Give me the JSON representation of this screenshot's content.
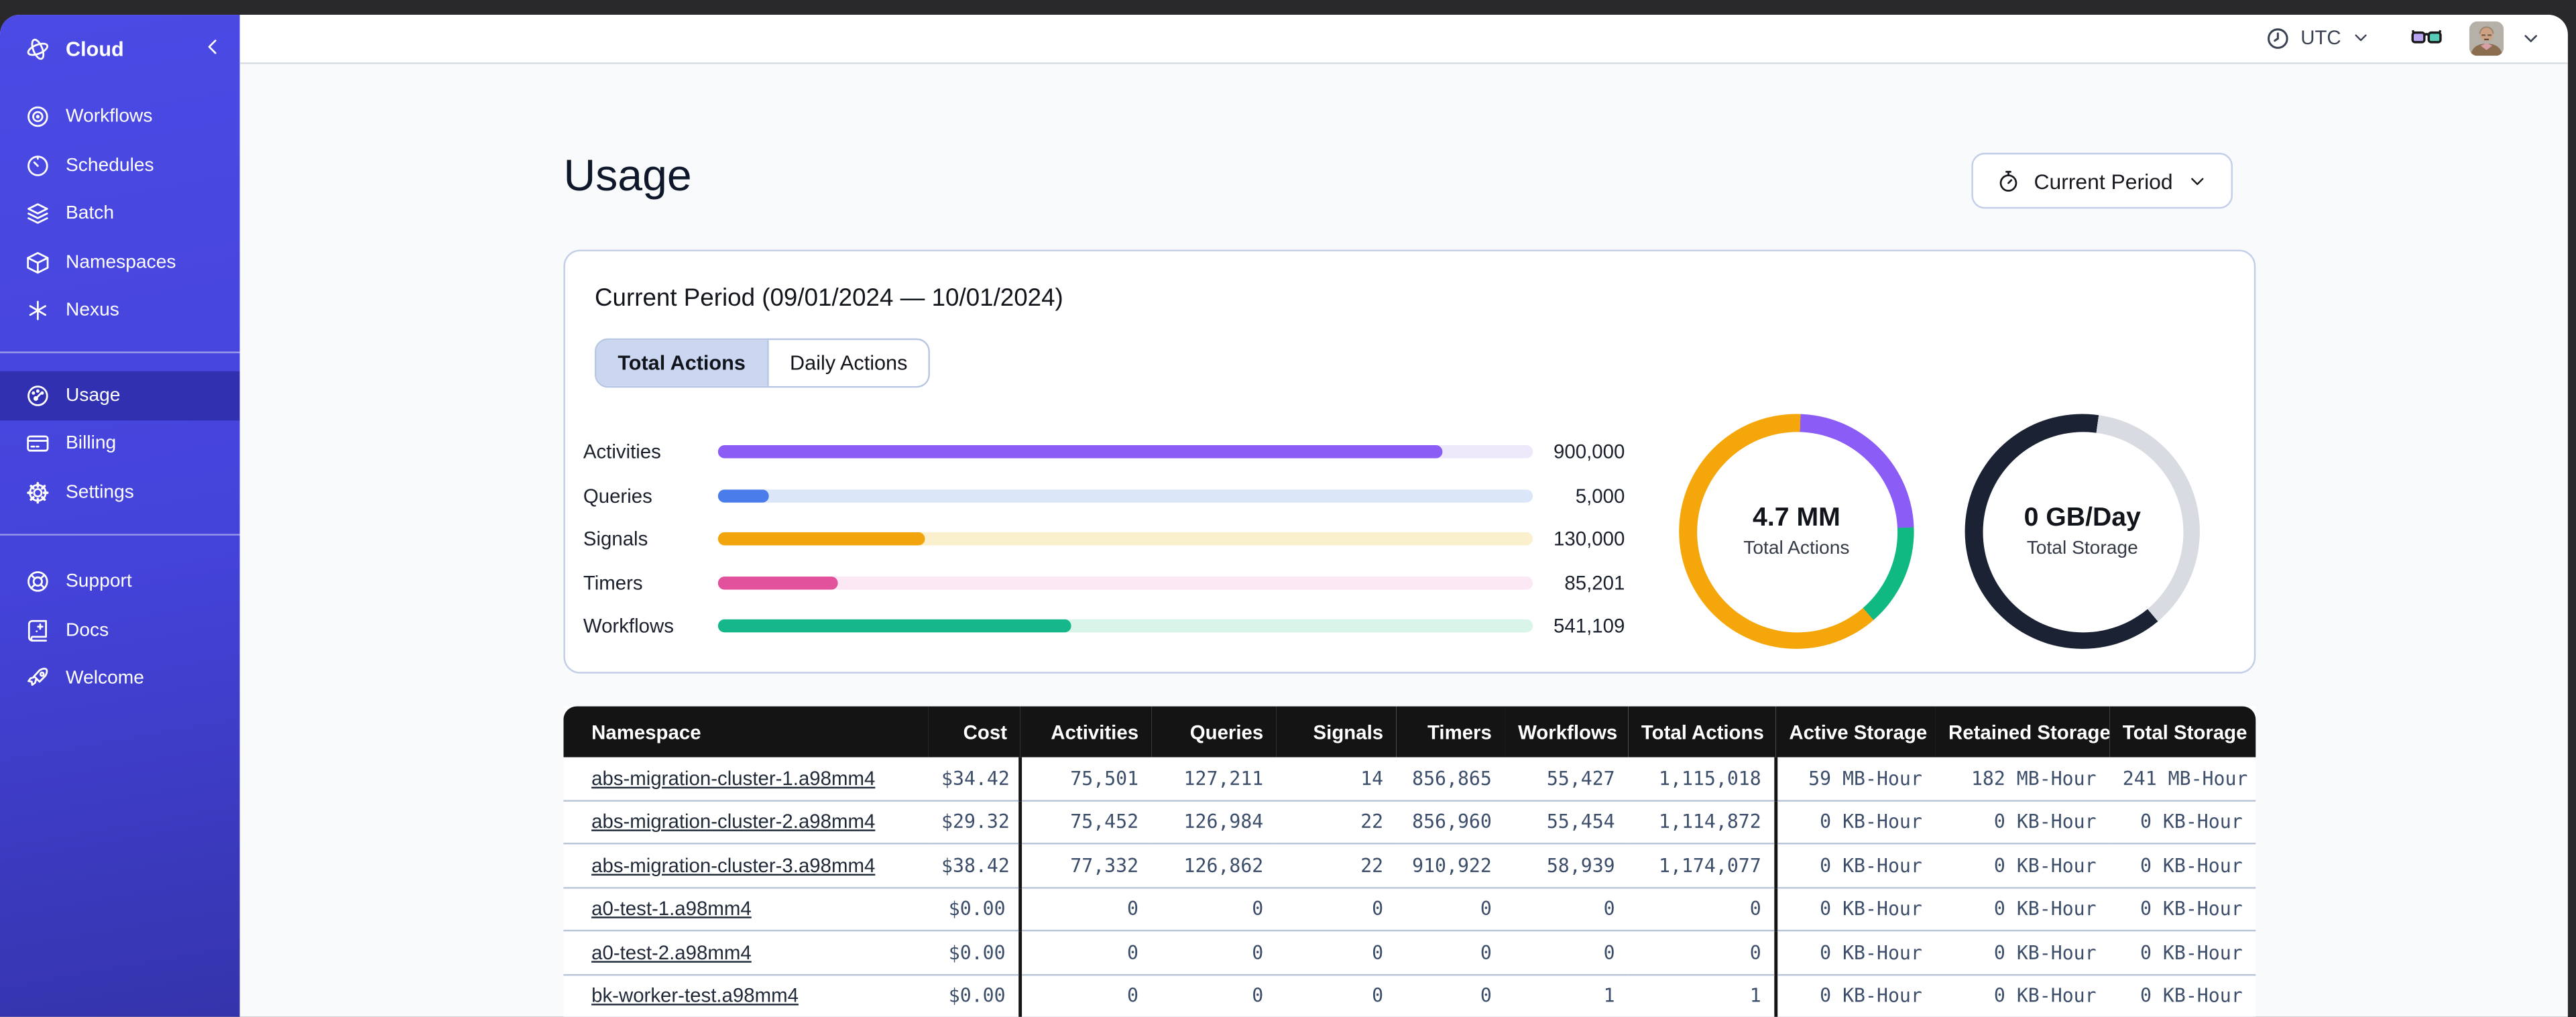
{
  "sidebar": {
    "brand": {
      "label": "Cloud",
      "icon": "temporal-logo"
    },
    "collapse_icon": "chevron-left",
    "groups": [
      {
        "items": [
          {
            "label": "Workflows",
            "icon": "workflows",
            "active": false
          },
          {
            "label": "Schedules",
            "icon": "schedules",
            "active": false
          },
          {
            "label": "Batch",
            "icon": "batch",
            "active": false
          },
          {
            "label": "Namespaces",
            "icon": "namespaces",
            "active": false
          },
          {
            "label": "Nexus",
            "icon": "nexus",
            "active": false
          }
        ]
      },
      {
        "items": [
          {
            "label": "Usage",
            "icon": "usage",
            "active": true
          },
          {
            "label": "Billing",
            "icon": "billing",
            "active": false
          },
          {
            "label": "Settings",
            "icon": "settings",
            "active": false
          }
        ]
      },
      {
        "items": [
          {
            "label": "Support",
            "icon": "support",
            "active": false
          },
          {
            "label": "Docs",
            "icon": "docs",
            "active": false
          },
          {
            "label": "Welcome",
            "icon": "welcome",
            "active": false
          }
        ]
      }
    ]
  },
  "header": {
    "timezone": "UTC"
  },
  "page": {
    "title": "Usage",
    "period_button_label": "Current Period"
  },
  "usage_card": {
    "title": "Current Period (09/01/2024 — 10/01/2024)",
    "tabs": [
      {
        "label": "Total Actions",
        "active": true
      },
      {
        "label": "Daily Actions",
        "active": false
      }
    ]
  },
  "chart_data": [
    {
      "type": "bar",
      "orientation": "horizontal",
      "categories": [
        "Activities",
        "Queries",
        "Signals",
        "Timers",
        "Workflows"
      ],
      "values": [
        900000,
        5000,
        130000,
        85201,
        541109
      ],
      "value_labels": [
        "900,000",
        "5,000",
        "130,000",
        "85,201",
        "541,109"
      ],
      "fill_fractions": [
        0.889,
        0.063,
        0.255,
        0.148,
        0.433
      ],
      "bar_colors": [
        "#8b5cf6",
        "#4a7deb",
        "#f2a40d",
        "#e1519c",
        "#16b78a"
      ],
      "track_colors": [
        "#ede9fb",
        "#dbe6f9",
        "#fbf0ce",
        "#fce7f5",
        "#d9f5e9"
      ]
    },
    {
      "type": "pie",
      "title": "4.7 MM",
      "subtitle": "Total Actions",
      "segments": [
        {
          "color": "#f5a60a",
          "from": 0,
          "to": 2
        },
        {
          "color": "#8b5cf6",
          "from": 2,
          "to": 88
        },
        {
          "color": "#10b981",
          "from": 88,
          "to": 139
        },
        {
          "color": "#f5a60a",
          "from": 139,
          "to": 360
        }
      ]
    },
    {
      "type": "pie",
      "title": "0 GB/Day",
      "subtitle": "Total Storage",
      "segments": [
        {
          "color": "#1b2234",
          "from": 0,
          "to": 8
        },
        {
          "color": "#d8dbe2",
          "from": 8,
          "to": 140
        },
        {
          "color": "#1b2234",
          "from": 140,
          "to": 360
        }
      ]
    }
  ],
  "table": {
    "headers": [
      "Namespace",
      "Cost",
      "Activities",
      "Queries",
      "Signals",
      "Timers",
      "Workflows",
      "Total Actions",
      "Active Storage",
      "Retained Storage",
      "Total Storage"
    ],
    "rows": [
      [
        "abs-migration-cluster-1.a98mm4",
        "$34.42",
        "75,501",
        "127,211",
        "14",
        "856,865",
        "55,427",
        "1,115,018",
        "59 MB-Hour",
        "182 MB-Hour",
        "241 MB-Hour"
      ],
      [
        "abs-migration-cluster-2.a98mm4",
        "$29.32",
        "75,452",
        "126,984",
        "22",
        "856,960",
        "55,454",
        "1,114,872",
        "0 KB-Hour",
        "0 KB-Hour",
        "0 KB-Hour"
      ],
      [
        "abs-migration-cluster-3.a98mm4",
        "$38.42",
        "77,332",
        "126,862",
        "22",
        "910,922",
        "58,939",
        "1,174,077",
        "0 KB-Hour",
        "0 KB-Hour",
        "0 KB-Hour"
      ],
      [
        "a0-test-1.a98mm4",
        "$0.00",
        "0",
        "0",
        "0",
        "0",
        "0",
        "0",
        "0 KB-Hour",
        "0 KB-Hour",
        "0 KB-Hour"
      ],
      [
        "a0-test-2.a98mm4",
        "$0.00",
        "0",
        "0",
        "0",
        "0",
        "0",
        "0",
        "0 KB-Hour",
        "0 KB-Hour",
        "0 KB-Hour"
      ],
      [
        "bk-worker-test.a98mm4",
        "$0.00",
        "0",
        "0",
        "0",
        "0",
        "1",
        "1",
        "0 KB-Hour",
        "0 KB-Hour",
        "0 KB-Hour"
      ]
    ]
  }
}
